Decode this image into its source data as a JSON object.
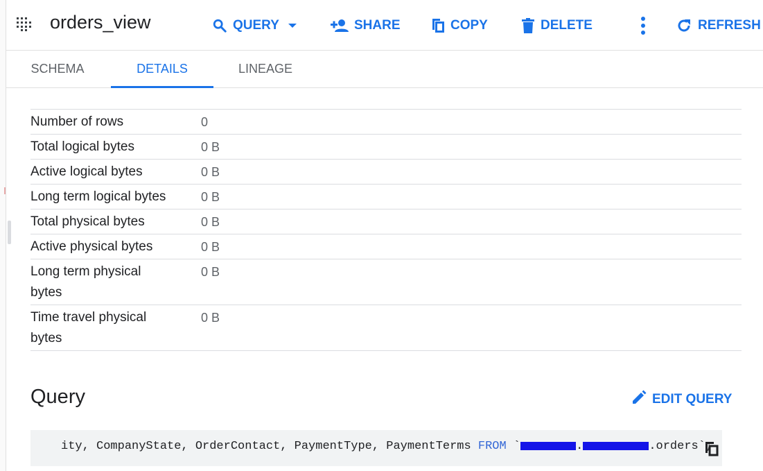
{
  "toolbar": {
    "title": "orders_view",
    "query": "QUERY",
    "share": "SHARE",
    "copy": "COPY",
    "delete": "DELETE",
    "refresh": "REFRESH"
  },
  "tabs": [
    "SCHEMA",
    "DETAILS",
    "LINEAGE"
  ],
  "active_tab": "DETAILS",
  "details": {
    "rows": [
      {
        "label": "Number of rows",
        "value": "0"
      },
      {
        "label": "Total logical bytes",
        "value": "0 B"
      },
      {
        "label": "Active logical bytes",
        "value": "0 B"
      },
      {
        "label": "Long term logical bytes",
        "value": "0 B"
      },
      {
        "label": "Total physical bytes",
        "value": "0 B"
      },
      {
        "label": "Active physical bytes",
        "value": "0 B"
      },
      {
        "label": "Long term physical bytes",
        "value": "0 B"
      },
      {
        "label": "Time travel physical bytes",
        "value": "0 B"
      }
    ]
  },
  "query": {
    "title": "Query",
    "edit_label": "EDIT QUERY",
    "code_prefix": "ity, CompanyState, OrderContact, PaymentType, PaymentTerms ",
    "code_keyword": "FROM",
    "code_suffix": ".orders`;"
  },
  "colors": {
    "accent": "#1a73e8",
    "redaction": "#1515e8"
  }
}
